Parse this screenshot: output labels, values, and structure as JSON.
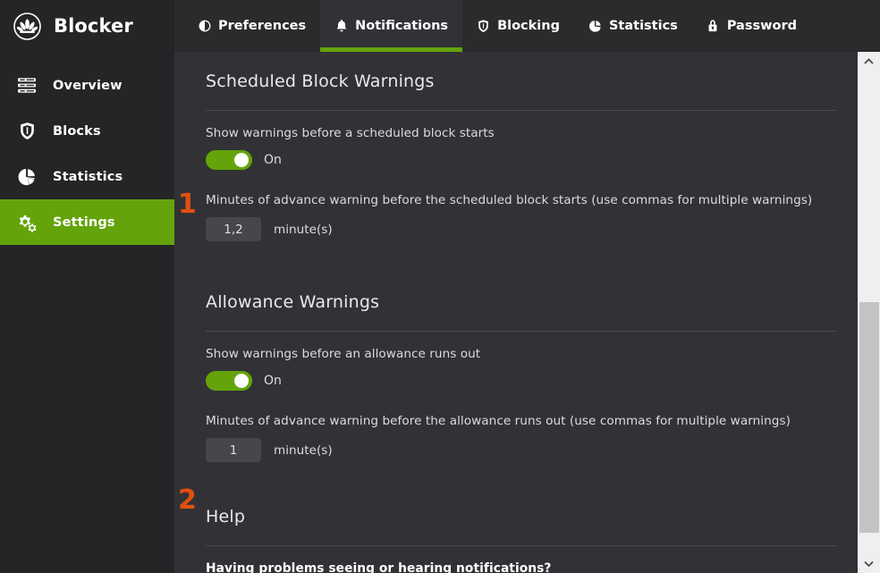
{
  "app": {
    "brand_name": "Blocker",
    "brand_logo_icon": "lotus-circle-logo"
  },
  "sidebar": {
    "items": [
      {
        "label": "Overview",
        "icon": "list-lines-icon",
        "active": false
      },
      {
        "label": "Blocks",
        "icon": "shield-icon",
        "active": false
      },
      {
        "label": "Statistics",
        "icon": "pie-chart-icon",
        "active": false
      },
      {
        "label": "Settings",
        "icon": "gears-icon",
        "active": true
      }
    ]
  },
  "tabs": [
    {
      "label": "Preferences",
      "icon": "contrast-circle-icon",
      "active": false
    },
    {
      "label": "Notifications",
      "icon": "bell-icon",
      "active": true
    },
    {
      "label": "Blocking",
      "icon": "shield-icon",
      "active": false
    },
    {
      "label": "Statistics",
      "icon": "pie-chart-icon",
      "active": false
    },
    {
      "label": "Password",
      "icon": "lock-icon",
      "active": false
    }
  ],
  "content": {
    "scheduled": {
      "heading": "Scheduled Block Warnings",
      "toggle_label": "Show warnings before a scheduled block starts",
      "toggle_state": "On",
      "minutes_label": "Minutes of advance warning before the scheduled block starts (use commas for multiple warnings)",
      "minutes_value": "1,2",
      "minutes_unit": "minute(s)"
    },
    "allowance": {
      "heading": "Allowance Warnings",
      "toggle_label": "Show warnings before an allowance runs out",
      "toggle_state": "On",
      "minutes_label": "Minutes of advance warning before the allowance runs out (use commas for multiple warnings)",
      "minutes_value": "1",
      "minutes_unit": "minute(s)"
    },
    "help": {
      "heading": "Help",
      "question": "Having problems seeing or hearing notifications?"
    }
  },
  "markers": [
    {
      "number": "1"
    },
    {
      "number": "2"
    }
  ],
  "scrollbar": {
    "up_icon": "chevron-up-icon",
    "down_icon": "chevron-down-icon",
    "thumb_name": "scrollbar-thumb"
  },
  "colors": {
    "accent_green": "#64a30a",
    "marker_orange": "#e1500f",
    "sidebar_bg": "#252528",
    "header_bg": "#2b2b2e",
    "panel_bg": "#323236",
    "input_bg": "#46464b"
  }
}
